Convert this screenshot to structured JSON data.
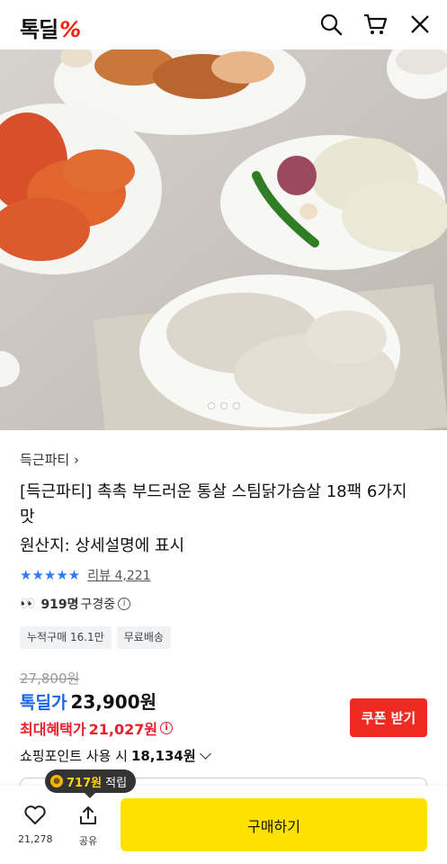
{
  "header": {
    "logo_text": "톡딜",
    "logo_mark": "%",
    "icons": [
      "search-icon",
      "cart-icon",
      "close-icon"
    ]
  },
  "product": {
    "brand": "득근파티",
    "title": "[득근파티] 촉촉 부드러운 통살 스팀닭가슴살 18팩 6가지맛",
    "origin": "원산지: 상세설명에 표시",
    "rating_stars": 5,
    "review_label": "리뷰 4,221",
    "viewers_count": "919명",
    "viewers_label": "구경중",
    "badges": [
      "누적구매 16.1만",
      "무료배송"
    ],
    "original_price": "27,800원",
    "sale_label": "톡딜가",
    "sale_price": "23,900원",
    "max_benefit_label": "최대혜택가",
    "max_benefit_price": "21,027원",
    "coupon_button": "쿠폰 받기",
    "points_label": "쇼핑포인트 사용 시",
    "points_price": "18,134원",
    "carousel_index": 1,
    "carousel_total": 3
  },
  "bottom_bar": {
    "reward_tip_amount": "717원",
    "reward_tip_label": "적립",
    "like_count": "21,278",
    "share_label": "공유",
    "buy_button": "구매하기"
  },
  "colors": {
    "accent_red": "#ee2b23",
    "accent_blue": "#1d63e6",
    "buy_yellow": "#ffe100",
    "star_blue": "#2c7cf6"
  }
}
